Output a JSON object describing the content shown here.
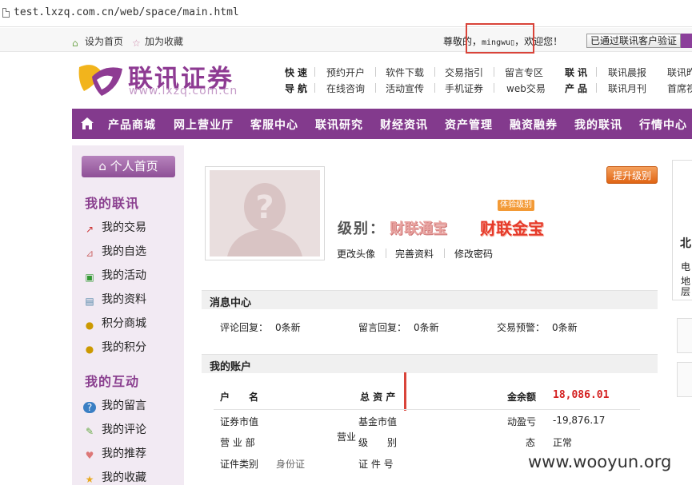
{
  "browser": {
    "url": "test.lxzq.com.cn/web/space/main.html"
  },
  "topbar": {
    "set_home": "设为首页",
    "add_fav": "加为收藏",
    "greeting_prefix": "尊敬的，",
    "username": "mingwu",
    "greeting_suffix": "，欢迎您！",
    "verify_button": "已通过联讯客户验证"
  },
  "logo": {
    "cn": "联讯证券",
    "en": "www.lxzq.com.cn"
  },
  "quicknav": {
    "head1": "快速",
    "head2": "导航",
    "row1": [
      "预约开户",
      "软件下载",
      "交易指引",
      "留言专区"
    ],
    "row2": [
      "在线咨询",
      "活动宣传",
      "手机证券",
      "web交易"
    ],
    "head3": "联讯",
    "head4": "产品",
    "row3": [
      "联讯晨报",
      "联讯昨"
    ],
    "row4": [
      "联讯月刊",
      "首席视"
    ]
  },
  "mainnav": [
    "产品商城",
    "网上营业厅",
    "客服中心",
    "联讯研究",
    "财经资讯",
    "资产管理",
    "融资融券",
    "我的联讯",
    "行情中心"
  ],
  "sidebar": {
    "home_button": "个人首页",
    "section1": "我的联讯",
    "items1": [
      "我的交易",
      "我的自选",
      "我的活动",
      "我的资料",
      "积分商城",
      "我的积分"
    ],
    "section2": "我的互动",
    "items2": [
      "我的留言",
      "我的评论",
      "我的推荐",
      "我的收藏"
    ]
  },
  "profile": {
    "upgrade": "提升级别",
    "trial_tag": "体验级别",
    "level_label": "级别：",
    "level_current": "财联通宝",
    "level_next": "财联金宝",
    "links": [
      "更改头像",
      "完善资料",
      "修改密码"
    ]
  },
  "messages": {
    "title": "消息中心",
    "comment_label": "评论回复：",
    "comment_value": "0条新",
    "message_label": "留言回复：",
    "message_value": "0条新",
    "alert_label": "交易预警：",
    "alert_value": "0条新"
  },
  "account": {
    "title": "我的账户",
    "name_label": "户　　名",
    "assets_label": "总 资 产",
    "balance_label": "金余额",
    "balance_value": "18,086.01",
    "securities_label": "证券市值",
    "fund_label": "基金市值",
    "pnl_label": "动盈亏",
    "pnl_value": "-19,876.17",
    "branch_label": "营 业 部",
    "branch_frag": "营业",
    "level_label": "级　　别",
    "status_label": "态",
    "status_value": "正常",
    "id_type_label": "证件类别",
    "id_type_value": "身份证",
    "id_no_label": "证 件 号"
  },
  "right_edge": {
    "title_frag": "北",
    "line1": "电",
    "line2": "地",
    "line3": "层"
  },
  "watermark": "www.wooyun.org"
}
